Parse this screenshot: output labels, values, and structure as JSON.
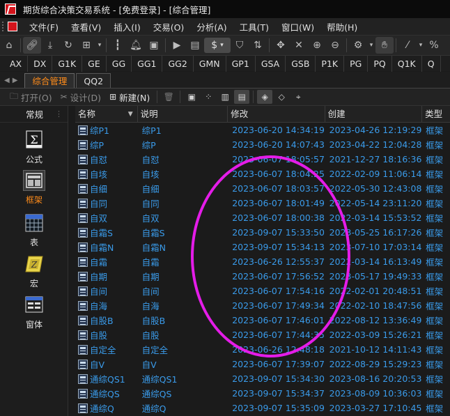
{
  "window": {
    "title": "期货综合决策交易系统 - [免费登录] - [综合管理]"
  },
  "menu": [
    "文件(F)",
    "查看(V)",
    "插入(I)",
    "交易(O)",
    "分析(A)",
    "工具(T)",
    "窗口(W)",
    "帮助(H)"
  ],
  "toolbar": {
    "currency_symbol": "$"
  },
  "periods": [
    "AX",
    "DX",
    "G1K",
    "GE",
    "GG",
    "GG1",
    "GG2",
    "GMN",
    "GP1",
    "GSA",
    "GSB",
    "P1K",
    "PG",
    "PQ",
    "Q1K",
    "Q"
  ],
  "tabs": [
    {
      "label": "综合管理",
      "active": true
    },
    {
      "label": "QQ2",
      "active": false
    }
  ],
  "actions": {
    "open": "打开(O)",
    "design": "设计(D)",
    "new": "新建(N)"
  },
  "sidebar": {
    "header": "常规",
    "items": [
      {
        "label": "公式",
        "icon": "formula-icon",
        "selected": false
      },
      {
        "label": "框架",
        "icon": "frame-icon",
        "selected": true
      },
      {
        "label": "表",
        "icon": "table-icon",
        "selected": false
      },
      {
        "label": "宏",
        "icon": "macro-icon",
        "selected": false
      },
      {
        "label": "窗体",
        "icon": "form-icon",
        "selected": false
      }
    ]
  },
  "list": {
    "columns": [
      "名称",
      "说明",
      "修改",
      "创建",
      "类型"
    ],
    "rows": [
      [
        "综P1",
        "综P1",
        "2023-06-20 14:34:19",
        "2023-04-26 12:19:29",
        "框架"
      ],
      [
        "综P",
        "综P",
        "2023-06-20 14:07:43",
        "2023-04-22 12:04:28",
        "框架"
      ],
      [
        "自怼",
        "自怼",
        "2023-06-07 18:05:57",
        "2021-12-27 18:16:36",
        "框架"
      ],
      [
        "自垓",
        "自垓",
        "2023-06-07 18:04:25",
        "2022-02-09 11:06:14",
        "框架"
      ],
      [
        "自细",
        "自细",
        "2023-06-07 18:03:57",
        "2022-05-30 12:43:08",
        "框架"
      ],
      [
        "自同",
        "自同",
        "2023-06-07 18:01:49",
        "2022-05-14 23:11:20",
        "框架"
      ],
      [
        "自双",
        "自双",
        "2023-06-07 18:00:38",
        "2022-03-14 15:53:52",
        "框架"
      ],
      [
        "自霜S",
        "自霜S",
        "2023-09-07 15:33:50",
        "2023-05-25 16:17:26",
        "框架"
      ],
      [
        "自霜N",
        "自霜N",
        "2023-09-07 15:34:13",
        "2023-07-10 17:03:14",
        "框架"
      ],
      [
        "自霜",
        "自霜",
        "2023-06-26 12:55:37",
        "2022-03-14 16:13:49",
        "框架"
      ],
      [
        "自期",
        "自期",
        "2023-06-07 17:56:52",
        "2023-05-17 19:49:33",
        "框架"
      ],
      [
        "自间",
        "自间",
        "2023-06-07 17:54:16",
        "2022-02-01 20:48:51",
        "框架"
      ],
      [
        "自海",
        "自海",
        "2023-06-07 17:49:34",
        "2022-02-10 18:47:56",
        "框架"
      ],
      [
        "自股B",
        "自股B",
        "2023-06-07 17:46:01",
        "2022-08-12 13:36:49",
        "框架"
      ],
      [
        "自股",
        "自股",
        "2023-06-07 17:44:35",
        "2022-03-09 15:26:21",
        "框架"
      ],
      [
        "自定全",
        "自定全",
        "2023-06-26 12:48:18",
        "2021-10-12 14:11:43",
        "框架"
      ],
      [
        "自V",
        "自V",
        "2023-06-07 17:39:07",
        "2022-08-29 15:29:23",
        "框架"
      ],
      [
        "通综QS1",
        "通综QS1",
        "2023-09-07 15:34:30",
        "2023-08-16 20:20:53",
        "框架"
      ],
      [
        "通综QS",
        "通综QS",
        "2023-09-07 15:34:37",
        "2023-08-09 10:36:03",
        "框架"
      ],
      [
        "通综Q",
        "通综Q",
        "2023-09-07 15:35:09",
        "2023-03-27 17:10:45",
        "框架"
      ]
    ]
  },
  "colors": {
    "accent": "#ff8c1a",
    "link_text": "#3a9bea",
    "annotation": "#e41ce8"
  }
}
